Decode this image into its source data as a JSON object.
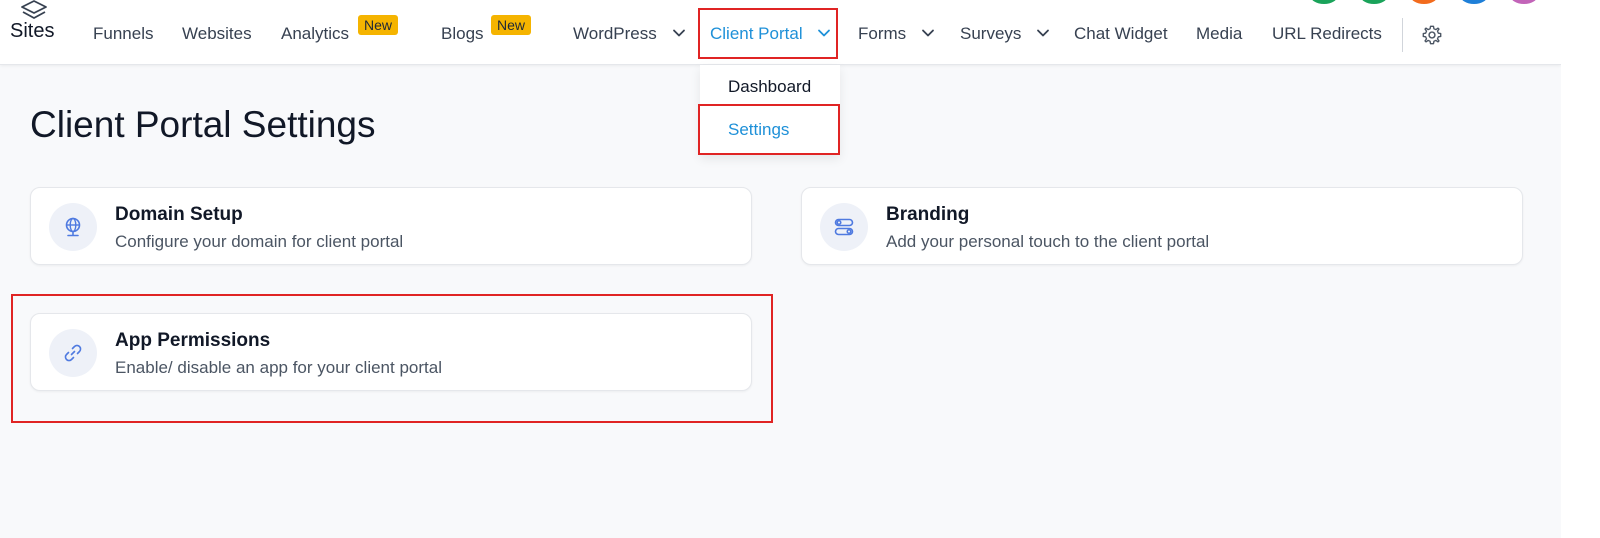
{
  "app": {
    "brand": "Sites"
  },
  "nav": {
    "funnels": "Funnels",
    "websites": "Websites",
    "analytics": "Analytics",
    "analytics_badge": "New",
    "blogs": "Blogs",
    "blogs_badge": "New",
    "wordpress": "WordPress",
    "client_portal": "Client Portal",
    "forms": "Forms",
    "surveys": "Surveys",
    "chat_widget": "Chat Widget",
    "media": "Media",
    "url_redirects": "URL Redirects",
    "settings_icon": "gear-icon"
  },
  "dropdown": {
    "items": [
      {
        "label": "Dashboard"
      },
      {
        "label": "Settings"
      }
    ]
  },
  "page": {
    "title": "Client Portal Settings"
  },
  "cards": [
    {
      "title": "Domain Setup",
      "description": "Configure your domain for client portal",
      "icon": "globe-icon"
    },
    {
      "title": "Branding",
      "description": "Add your personal touch to the client portal",
      "icon": "toggles-icon"
    },
    {
      "title": "App Permissions",
      "description": "Enable/ disable an app for your client portal",
      "icon": "link-icon"
    }
  ],
  "colors": {
    "accent": "#1e90d8",
    "highlight_box": "#e02424",
    "badge": "#f5b400",
    "avatars": [
      "#1aa35a",
      "#1aa35a",
      "#f26b1d",
      "#1e7fd8",
      "#c264b8"
    ]
  }
}
